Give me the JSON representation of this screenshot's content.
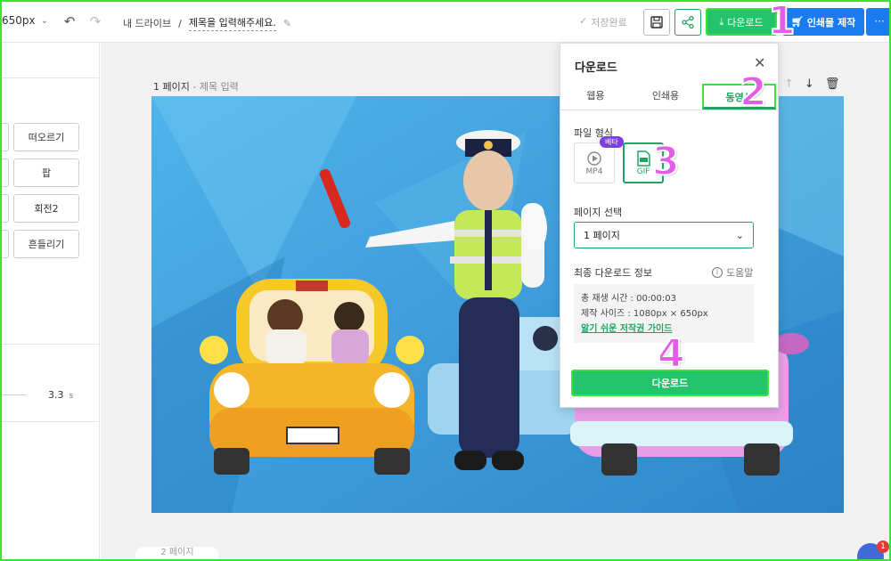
{
  "topbar": {
    "size_label": "650px",
    "breadcrumb_drive": "내 드라이브",
    "breadcrumb_sep": "/",
    "title_placeholder": "제목을 입력해주세요.",
    "save_status": "저장완료",
    "download_label": "다운로드",
    "print_label": "인쇄물 제작"
  },
  "left_panel": {
    "animations": [
      "떠오르기",
      "팝",
      "회전2",
      "흔들리기"
    ],
    "duration_value": "3.3",
    "duration_unit": "s"
  },
  "editor": {
    "page_label": "1 페이지",
    "page_title_placeholder": "제목 입력",
    "page2_label": "2 페이지",
    "help_badge_count": "1"
  },
  "download_panel": {
    "title": "다운로드",
    "tabs": [
      "웹용",
      "인쇄용",
      "동영상"
    ],
    "active_tab": "동영상",
    "file_format_label": "파일 형식",
    "formats": [
      {
        "name": "MP4",
        "badge": "베타"
      },
      {
        "name": "GIF",
        "badge": ""
      }
    ],
    "page_select_label": "페이지 선택",
    "page_select_value": "1 페이지",
    "final_info_label": "최종 다운로드 정보",
    "help_label": "도움말",
    "info": {
      "play_time": "총 재생 시간 : 00:00:03",
      "size": "제작 사이즈 : 1080px × 650px",
      "guide_link": "알기 쉬운 저작권 가이드"
    },
    "download_button": "다운로드"
  },
  "annotations": [
    "1",
    "2",
    "3",
    "4"
  ],
  "colors": {
    "accent_green": "#23c46b",
    "print_blue": "#1a7cf0",
    "highlight": "#3ee03e",
    "step_pink": "#e35ee8"
  }
}
